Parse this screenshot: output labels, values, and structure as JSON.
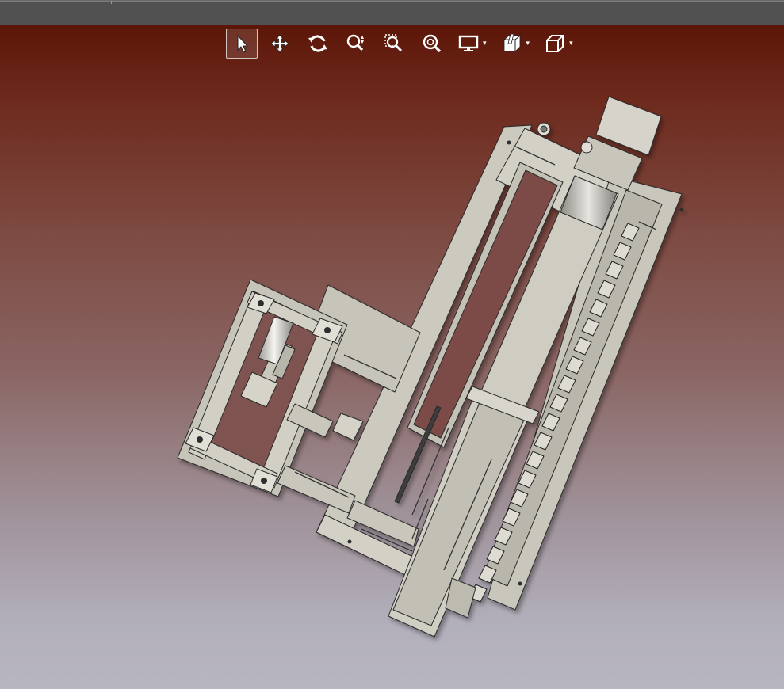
{
  "window": {
    "title": ""
  },
  "toolbar": {
    "tools": [
      {
        "id": "select",
        "icon": "select-arrow-icon",
        "active": true
      },
      {
        "id": "pan",
        "icon": "pan-move-icon",
        "active": false
      },
      {
        "id": "rotate",
        "icon": "rotate-icon",
        "active": false
      },
      {
        "id": "zoom-dynamic",
        "icon": "zoom-dynamic-icon",
        "active": false
      },
      {
        "id": "zoom-window",
        "icon": "zoom-window-icon",
        "active": false
      },
      {
        "id": "zoom-fit",
        "icon": "zoom-fit-icon",
        "active": false
      },
      {
        "id": "display-mode",
        "icon": "monitor-icon",
        "has_dropdown": true
      },
      {
        "id": "section-view",
        "icon": "section-cube-icon",
        "has_dropdown": true
      },
      {
        "id": "view-orientation",
        "icon": "cube-view-icon",
        "has_dropdown": true
      }
    ],
    "dropdown_glyph": "▾"
  },
  "viewport": {
    "background_top": "#5c1608",
    "background_bottom": "#b8b6c1",
    "model_color": "#ccc9bf",
    "model_outline": "#2a2a2a"
  }
}
